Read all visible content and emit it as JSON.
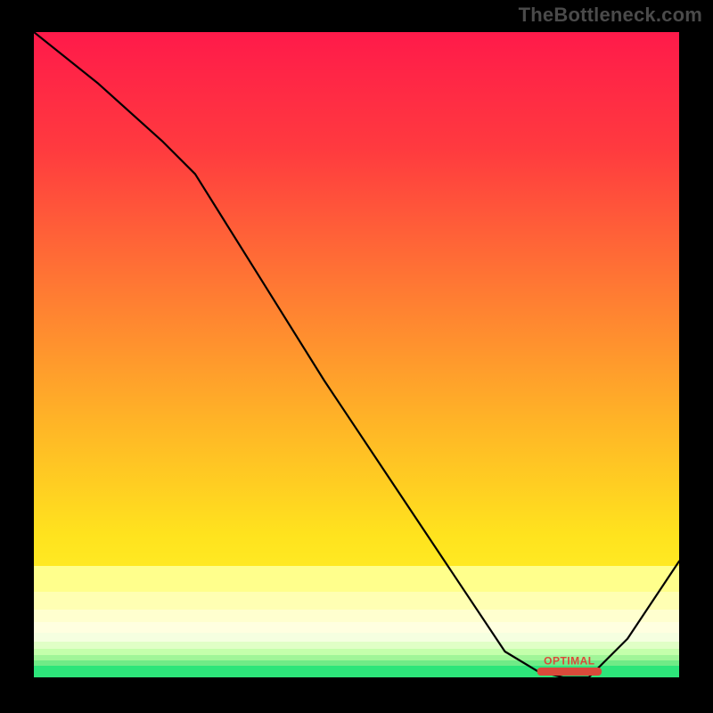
{
  "watermark": "TheBottleneck.com",
  "chart_data": {
    "type": "line",
    "title": "",
    "xlabel": "",
    "ylabel": "",
    "xlim": [
      0,
      100
    ],
    "ylim": [
      0,
      100
    ],
    "x": [
      0,
      10,
      20,
      25,
      35,
      45,
      55,
      65,
      73,
      78,
      82,
      86,
      92,
      100
    ],
    "values": [
      100,
      92,
      83,
      78,
      62,
      46,
      31,
      16,
      4,
      1,
      0,
      0,
      6,
      18
    ],
    "optimal_range": [
      78,
      88
    ],
    "annotations": [
      {
        "kind": "optimal_label",
        "text": "OPTIMAL",
        "x": 83,
        "y": 2
      }
    ],
    "gradient_stops": [
      {
        "y": 100,
        "color": "#ff1a4a"
      },
      {
        "y": 60,
        "color": "#ff7a33"
      },
      {
        "y": 30,
        "color": "#ffe31e"
      },
      {
        "y": 12,
        "color": "#ffff8c"
      },
      {
        "y": 4,
        "color": "#c4ffab"
      },
      {
        "y": 0,
        "color": "#2de57a"
      }
    ]
  }
}
